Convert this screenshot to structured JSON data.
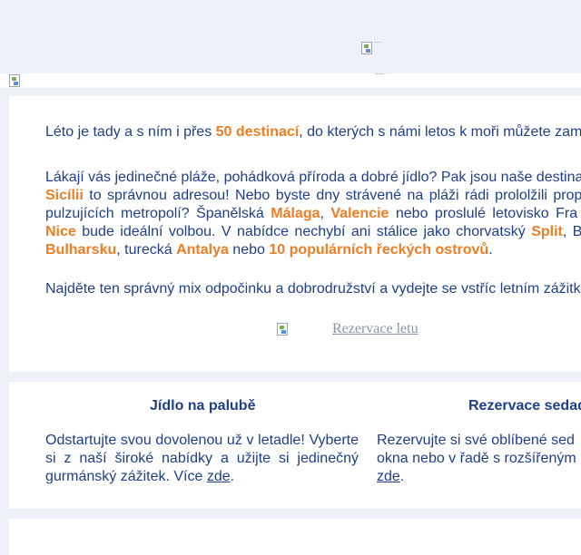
{
  "header": {
    "logo_alt": "",
    "banner_alt": ""
  },
  "intro": {
    "p1_before": "Léto je tady a s ním i přes ",
    "p1_hl": "50 destinací",
    "p1_after": ", do kterých s námi letos k moři můžete zam",
    "p2": {
      "l1": "Lákají vás jedinečné pláže, pohádková příroda a dobré jídlo? Pak jsou naše destina",
      "l2_hl": "Sicílii",
      "l2_rest": " to správnou adresou! Nebo byste dny strávené na pláži rádi prololžili prop",
      "l3_a": "pulzujících metropolí? Španělská ",
      "l3_hl1": "Málaga",
      "l3_b": ", ",
      "l3_hl2": "Valencie",
      "l3_c": " nebo proslulé letovisko Fra",
      "l4_hl1": "Nice",
      "l4_a": " bude ideální volbou. V nabídce nechybí ani stálice jako chorvatský ",
      "l4_hl2": "Split",
      "l4_b": ", B",
      "l5_hl1": "Bulharsku",
      "l5_a": ", turecká ",
      "l5_hl2": "Antalya",
      "l5_b": " nebo ",
      "l5_hl3": "10 populárních řeckých ostrovů",
      "l5_c": "."
    },
    "p3": "Najděte ten správný mix odpočinku a dobrodružství a vydejte se vstříc letním zážitk",
    "cta_label": "Rezervace letu"
  },
  "features": [
    {
      "title": "Jídlo na palubě",
      "text": "Odstartujte svou dovolenou už v letadle! Vyberte si z naší široké nabídky a užijte si jedinečný gurmánský zážitek. Více ",
      "link": "zde",
      "after": "."
    },
    {
      "title": "Rezervace sedad",
      "line1": "Rezervujte si své oblíbené sed",
      "line2": "okna nebo v řadě s rozšířeným",
      "link": "zde",
      "after": "."
    }
  ],
  "colors": {
    "background": "#eef1f7",
    "text": "#1f3f8b",
    "accent": "#ef7d24",
    "card": "#ffffff"
  }
}
